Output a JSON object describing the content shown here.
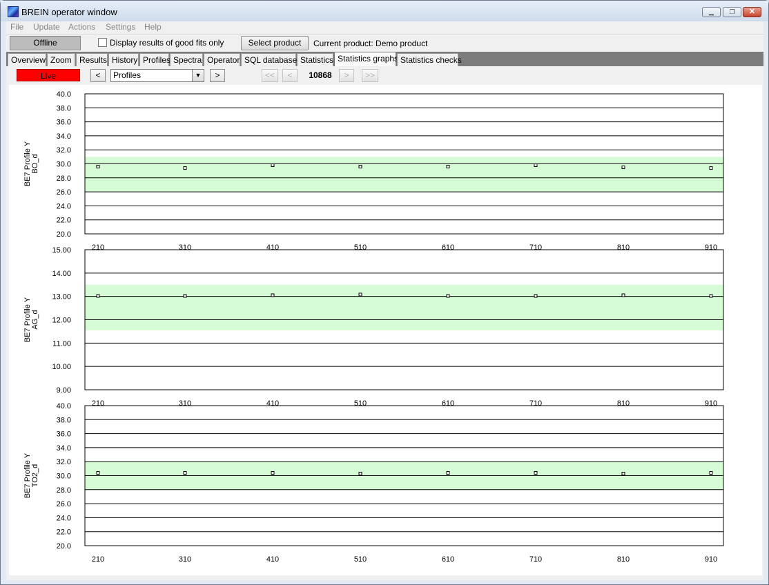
{
  "window": {
    "title": "BREIN operator window"
  },
  "menu": [
    "File",
    "Update",
    "Actions",
    "Settings",
    "Help"
  ],
  "toolbar": {
    "offline_label": "Offline",
    "good_fits_label": "Display results of good fits only",
    "good_fits_checked": false,
    "select_product_label": "Select product",
    "current_product_text": "Current product: Demo product"
  },
  "tabs": [
    "Overview",
    "Zoom",
    "Results",
    "History",
    "Profiles",
    "Spectra",
    "Operator",
    "SQL database",
    "Statistics",
    "Statistics graphs",
    "Statistics checks"
  ],
  "active_tab": "Statistics graphs",
  "nav": {
    "live_label": "Live",
    "prev_label": "<",
    "next_label": ">",
    "dropdown_value": "Profiles",
    "first_label": "<<",
    "back_label": "<",
    "forward_label": ">",
    "last_label": ">>",
    "record_number": "10868"
  },
  "colors": {
    "tolerance_band": "#d6fcd6",
    "live": "#ff0000"
  },
  "chart_data": [
    {
      "type": "scatter",
      "ylabel_lines": [
        "BE7  Profile Y",
        "BO_d"
      ],
      "x": [
        210,
        310,
        410,
        510,
        610,
        710,
        810,
        910
      ],
      "values": [
        29.6,
        29.4,
        29.8,
        29.6,
        29.6,
        29.8,
        29.5,
        29.4
      ],
      "ylim": [
        20.0,
        40.0
      ],
      "yticks": [
        "40.0",
        "38.0",
        "36.0",
        "34.0",
        "32.0",
        "30.0",
        "28.0",
        "26.0",
        "24.0",
        "22.0",
        "20.0"
      ],
      "band": [
        26.0,
        31.0
      ]
    },
    {
      "type": "scatter",
      "ylabel_lines": [
        "BE7  Profile Y",
        "AG_d"
      ],
      "x": [
        210,
        310,
        410,
        510,
        610,
        710,
        810,
        910
      ],
      "values": [
        13.02,
        13.02,
        13.05,
        13.08,
        13.02,
        13.02,
        13.05,
        13.02
      ],
      "ylim": [
        9.0,
        15.0
      ],
      "yticks": [
        "15.00",
        "14.00",
        "13.00",
        "12.00",
        "11.00",
        "10.00",
        "9.00"
      ],
      "band": [
        11.55,
        13.5
      ]
    },
    {
      "type": "scatter",
      "ylabel_lines": [
        "BE7  Profile Y",
        "TO2_d"
      ],
      "x": [
        210,
        310,
        410,
        510,
        610,
        710,
        810,
        910
      ],
      "values": [
        30.4,
        30.4,
        30.4,
        30.3,
        30.4,
        30.4,
        30.3,
        30.4
      ],
      "ylim": [
        20.0,
        40.0
      ],
      "yticks": [
        "40.0",
        "38.0",
        "36.0",
        "34.0",
        "32.0",
        "30.0",
        "28.0",
        "26.0",
        "24.0",
        "22.0",
        "20.0"
      ],
      "band": [
        28.0,
        32.0
      ]
    }
  ]
}
